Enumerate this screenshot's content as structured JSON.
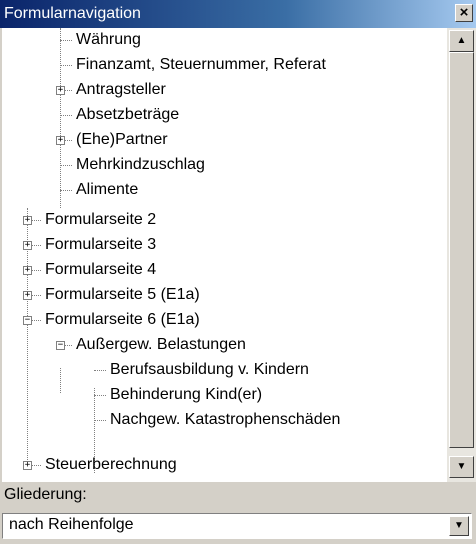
{
  "window": {
    "title": "Formularnavigation",
    "close_label": "×"
  },
  "tree": {
    "items": [
      {
        "label": "Währung",
        "expander": ""
      },
      {
        "label": "Finanzamt, Steuernummer, Referat",
        "expander": ""
      },
      {
        "label": "Antragsteller",
        "expander": "+"
      },
      {
        "label": "Absetzbeträge",
        "expander": ""
      },
      {
        "label": "(Ehe)Partner",
        "expander": "+"
      },
      {
        "label": "Mehrkindzuschlag",
        "expander": ""
      },
      {
        "label": "Alimente",
        "expander": ""
      },
      {
        "label": "Formularseite 2",
        "expander": "+"
      },
      {
        "label": "Formularseite 3",
        "expander": "+"
      },
      {
        "label": "Formularseite 4",
        "expander": "+"
      },
      {
        "label": "Formularseite 5 (E1a)",
        "expander": "+"
      },
      {
        "label": "Formularseite 6 (E1a)",
        "expander": "−"
      },
      {
        "label": "Außergew. Belastungen",
        "expander": "−"
      },
      {
        "label": "Berufsausbildung v. Kindern",
        "expander": ""
      },
      {
        "label": "Behinderung Kind(er)",
        "expander": ""
      },
      {
        "label": "Nachgew. Katastrophenschäden",
        "expander": ""
      },
      {
        "label": "Steuerberechnung",
        "expander": "+"
      }
    ]
  },
  "scrollbar": {
    "up_icon": "▲",
    "down_icon": "▼"
  },
  "gliederung": {
    "label": "Gliederung:",
    "selected": "nach Reihenfolge",
    "arrow": "▼"
  }
}
